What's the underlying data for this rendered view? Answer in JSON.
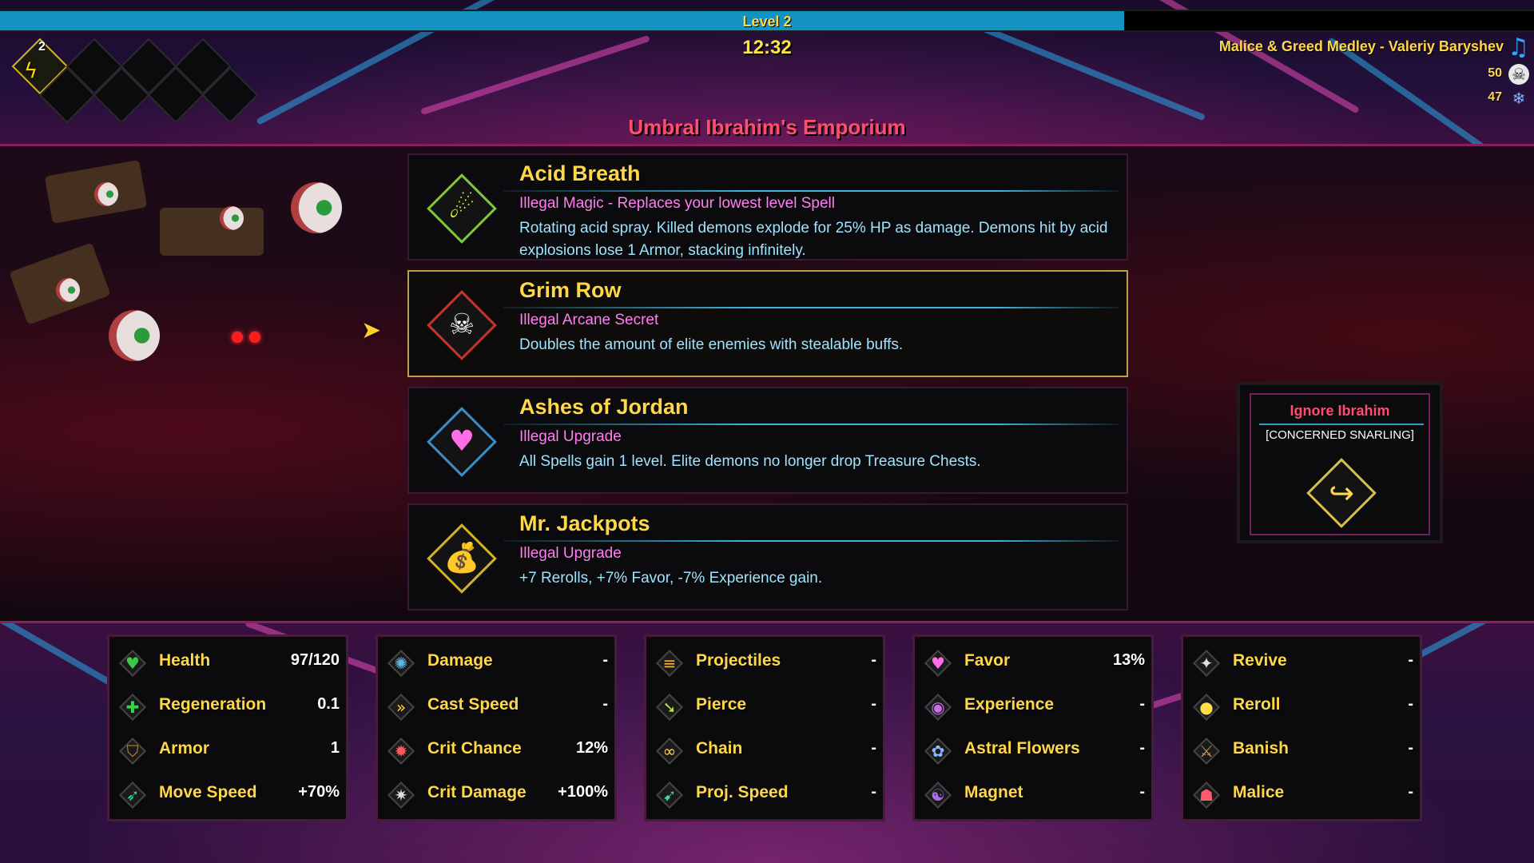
{
  "hud": {
    "level_label": "Level 2",
    "level_progress": 0.733,
    "timer": "12:32",
    "weapon_slot_level": "2",
    "music": "Malice & Greed Medley - Valeriy Baryshev",
    "skulls": "50",
    "flowers": "47",
    "shop_title": "Umbral Ibrahim's Emporium"
  },
  "cards": [
    {
      "title": "Acid Breath",
      "type": "Illegal Magic - Replaces your lowest level Spell",
      "desc": "Rotating acid spray. Killed demons explode for 25% HP as damage. Demons hit by acid explosions lose 1 Armor, stacking infinitely.",
      "icon": "acid-flame-icon",
      "frame_color": "#7ec83a",
      "glyph_color": "#d8ff40"
    },
    {
      "title": "Grim Row",
      "type": "Illegal Arcane Secret",
      "desc": "Doubles the amount of elite enemies with stealable buffs.",
      "icon": "skull-icon",
      "frame_color": "#c8322e",
      "glyph_color": "#ffffff"
    },
    {
      "title": "Ashes of Jordan",
      "type": "Illegal Upgrade",
      "desc": "All Spells gain 1 level. Elite demons no longer drop Treasure Chests.",
      "icon": "heart-spade-icon",
      "frame_color": "#3a8ec8",
      "glyph_color": "#ff6ee8"
    },
    {
      "title": "Mr. Jackpots",
      "type": "Illegal Upgrade",
      "desc": "+7 Rerolls, +7% Favor, -7% Experience gain.",
      "icon": "money-bag-icon",
      "frame_color": "#d4b22a",
      "glyph_color": "#ffe04a"
    }
  ],
  "ignore": {
    "title": "Ignore Ibrahim",
    "subtitle": "[CONCERNED SNARLING]",
    "icon": "skip-arrow-icon"
  },
  "stats": [
    [
      {
        "label": "Health",
        "value": "97/120",
        "icon": "heart-icon",
        "color": "#3ec84a"
      },
      {
        "label": "Regeneration",
        "value": "0.1",
        "icon": "plus-icon",
        "color": "#2ed84a"
      },
      {
        "label": "Armor",
        "value": "1",
        "icon": "shield-icon",
        "color": "#d08a3a"
      },
      {
        "label": "Move Speed",
        "value": "+70%",
        "icon": "boot-icon",
        "color": "#2ed8a0"
      }
    ],
    [
      {
        "label": "Damage",
        "value": "-",
        "icon": "brain-icon",
        "color": "#5ab8e8"
      },
      {
        "label": "Cast Speed",
        "value": "-",
        "icon": "fast-forward-icon",
        "color": "#ffd84a"
      },
      {
        "label": "Crit Chance",
        "value": "12%",
        "icon": "crosshair-icon",
        "color": "#ff5a5a"
      },
      {
        "label": "Crit Damage",
        "value": "+100%",
        "icon": "burst-icon",
        "color": "#e0e0e0"
      }
    ],
    [
      {
        "label": "Projectiles",
        "value": "-",
        "icon": "stacked-arrows-icon",
        "color": "#ffb03a"
      },
      {
        "label": "Pierce",
        "value": "-",
        "icon": "pierce-arrow-icon",
        "color": "#b8e83a"
      },
      {
        "label": "Chain",
        "value": "-",
        "icon": "chain-icon",
        "color": "#ffd84a"
      },
      {
        "label": "Proj. Speed",
        "value": "-",
        "icon": "wing-icon",
        "color": "#3ed8a0"
      }
    ],
    [
      {
        "label": "Favor",
        "value": "13%",
        "icon": "favor-heart-icon",
        "color": "#ff6ee8"
      },
      {
        "label": "Experience",
        "value": "-",
        "icon": "orb-icon",
        "color": "#c86ee8"
      },
      {
        "label": "Astral Flowers",
        "value": "-",
        "icon": "flower-icon",
        "color": "#8ab8ff"
      },
      {
        "label": "Magnet",
        "value": "-",
        "icon": "swirl-icon",
        "color": "#a86ee8"
      }
    ],
    [
      {
        "label": "Revive",
        "value": "-",
        "icon": "angel-wings-icon",
        "color": "#e0e0e0"
      },
      {
        "label": "Reroll",
        "value": "-",
        "icon": "reroll-bag-icon",
        "color": "#ffe04a"
      },
      {
        "label": "Banish",
        "value": "-",
        "icon": "banish-sword-icon",
        "color": "#c89a6a"
      },
      {
        "label": "Malice",
        "value": "-",
        "icon": "demon-face-icon",
        "color": "#ff5a6e"
      }
    ]
  ]
}
